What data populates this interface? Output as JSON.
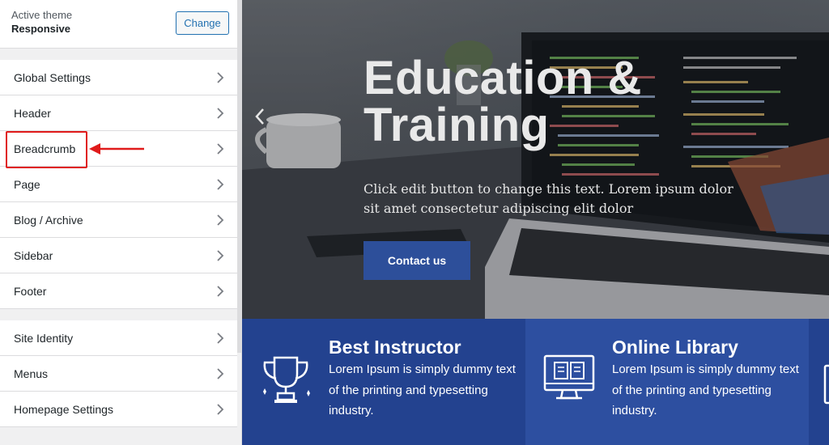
{
  "theme": {
    "label": "Active theme",
    "name": "Responsive",
    "change_label": "Change"
  },
  "menu_primary": [
    {
      "label": "Global Settings"
    },
    {
      "label": "Header"
    },
    {
      "label": "Breadcrumb"
    },
    {
      "label": "Page"
    },
    {
      "label": "Blog / Archive"
    },
    {
      "label": "Sidebar"
    },
    {
      "label": "Footer"
    }
  ],
  "menu_secondary": [
    {
      "label": "Site Identity"
    },
    {
      "label": "Menus"
    },
    {
      "label": "Homepage Settings"
    }
  ],
  "hero": {
    "title_line1": "Education &",
    "title_line2": "Training",
    "subtitle": "Click edit button to change this text. Lorem ipsum dolor sit amet consectetur adipiscing elit dolor",
    "button_label": "Contact us"
  },
  "features": [
    {
      "title": "Best Instructor",
      "text": "Lorem Ipsum is simply dummy text of the printing and typesetting industry.",
      "icon": "trophy-icon"
    },
    {
      "title": "Online Library",
      "text": "Lorem Ipsum is simply dummy text of the printing and typesetting industry.",
      "icon": "monitor-book-icon"
    }
  ],
  "colors": {
    "accent": "#2271b1",
    "highlight": "#e01b1b",
    "features_bg": "#23428f",
    "features_bg_alt": "#2d4fa0",
    "hero_button": "#2d4f9a"
  }
}
